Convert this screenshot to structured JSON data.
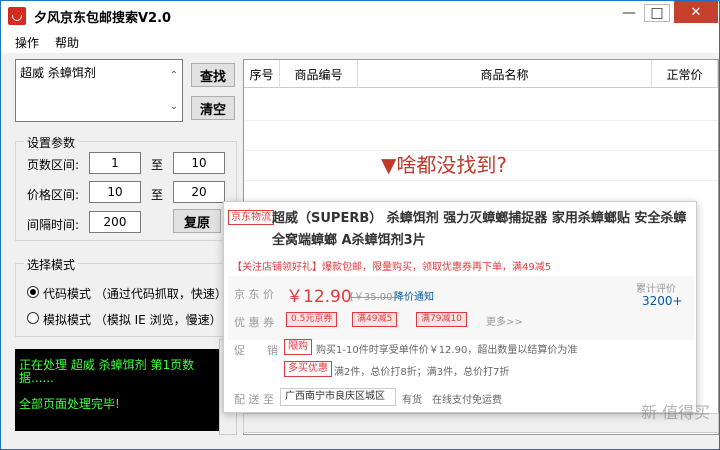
{
  "window": {
    "title": "夕风京东包邮搜索V2.0",
    "min": "—",
    "max": "□",
    "close": "✕"
  },
  "menu": {
    "items": [
      "操作",
      "帮助"
    ]
  },
  "search": {
    "value": "超威 杀蟑饵剂",
    "button": "查找",
    "clear_button": "清空"
  },
  "settings": {
    "group_label": "设置参数",
    "page_label": "页数区间:",
    "page_from": "1",
    "page_to": "10",
    "price_label": "价格区间:",
    "price_from": "10",
    "price_to": "20",
    "interval_label": "间隔时间:",
    "interval": "200",
    "to": "至",
    "copy_button": "复原"
  },
  "mode": {
    "group_label": "选择模式",
    "code_mode": "代码模式 （通过代码抓取，快速）",
    "sim_mode": "模拟模式 （模拟 IE 浏览，慢速）",
    "selected": "code"
  },
  "console": {
    "lines": [
      "正在处理 超威 杀蟑饵剂 第1页数据......",
      "",
      "全部页面处理完毕!"
    ]
  },
  "grid": {
    "columns": [
      "序号",
      "商品编号",
      "商品名称",
      "正常价"
    ],
    "empty_message": "▼啥都没找到?"
  },
  "product_popup": {
    "tag": "京东物流",
    "title": "超威（SUPERB） 杀蟑饵剂 强力灭蟑螂捕捉器 家用杀蟑螂贴 安全杀蟑全窝端蟑螂 A杀蟑饵剂3片",
    "promo": "【关注店铺领好礼】爆款包邮，限量购买，领取优惠券再下单，满49减5",
    "price_label": "京 东 价",
    "price": "￥12.90",
    "old_price": "[￥35.00]",
    "notify": "降价通知",
    "comment_label": "累计评价",
    "comment_count": "3200+",
    "coupon_label": "优 惠 券",
    "coupons": [
      "0.5元京券",
      "满49减5",
      "满79减10"
    ],
    "more": "更多>>",
    "promo_label": "促　　销",
    "limit_tag": "限购",
    "limit_text": "购买1-10件时享受单件价￥12.90，超出数量以结算价为准",
    "multi_tag": "多买优惠",
    "multi_text": "满2件，总价打8折；满3件，总价打7折",
    "ship_label": "配 送 至",
    "region": "广西南宁市良庆区城区",
    "stock": "有货",
    "pay": "在线支付免运费"
  },
  "watermark": "新 值得买"
}
